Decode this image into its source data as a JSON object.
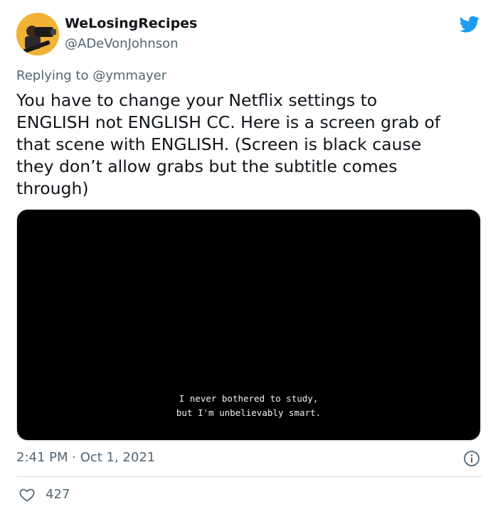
{
  "author": {
    "display_name": "WeLosingRecipes",
    "handle": "@ADeVonJohnson",
    "avatar": "avatar"
  },
  "platform_icon": "twitter-bird-icon",
  "reply": {
    "prefix": "Replying to",
    "mention": "@ymmayer"
  },
  "tweet": {
    "text": "You have to change your Netflix settings to\nENGLISH not ENGLISH CC. Here is a screen grab of\nthat scene with ENGLISH. (Screen is black cause\nthey don’t allow grabs but the subtitle comes\nthrough)"
  },
  "media": {
    "subtitle": "I never bothered to study,\nbut I'm unbelievably smart."
  },
  "meta": {
    "timestamp": "2:41 PM · Oct 1, 2021"
  },
  "stats": {
    "likes": "427"
  },
  "colors": {
    "text": "#0f1419",
    "secondary": "#536471",
    "brand": "#1d9bf0",
    "border": "#cfd9de"
  }
}
